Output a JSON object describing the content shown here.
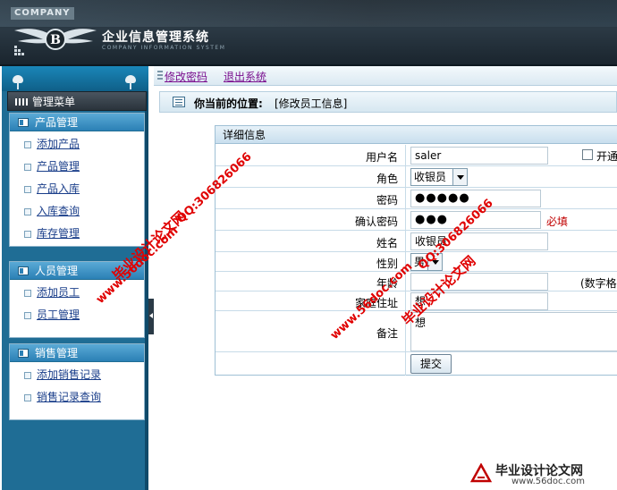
{
  "header": {
    "company_tag": "COMPANY",
    "title": "企业信息管理系统",
    "subtitle": "COMPANY INFORMATION SYSTEM",
    "logo_letter": "B"
  },
  "toolbar": {
    "change_password": "修改密码",
    "logout": "退出系统"
  },
  "sidebar": {
    "menu_title": "管理菜单",
    "groups": [
      {
        "title": "产品管理",
        "items": [
          "添加产品",
          "产品管理",
          "产品入库",
          "入库查询",
          "库存管理"
        ]
      },
      {
        "title": "人员管理",
        "items": [
          "添加员工",
          "员工管理"
        ]
      },
      {
        "title": "销售管理",
        "items": [
          "添加销售记录",
          "销售记录查询"
        ]
      }
    ]
  },
  "location": {
    "label": "你当前的位置:",
    "value": "[修改员工信息]"
  },
  "form": {
    "header": "详细信息",
    "username_label": "用户名",
    "username_value": "saler",
    "enable_label": "开通",
    "role_label": "角色",
    "role_value": "收银员",
    "password_label": "密码",
    "password_value": "●●●●●",
    "confirm_label": "确认密码",
    "confirm_value": "●●●",
    "required_text": "必填",
    "name_label": "姓名",
    "name_value": "收银员",
    "gender_label": "性别",
    "gender_value": "男",
    "age_label": "年龄",
    "age_value": "",
    "age_hint": "(数字格",
    "address_label": "家庭住址",
    "address_value": "想",
    "remark_label": "备注",
    "remark_value": "想",
    "submit_label": "提交"
  },
  "watermarks": {
    "site_name": "毕业设计论文网",
    "site_url": "www.56doc.com",
    "qq": "QQ:306826066",
    "brand_url": "www.56doc.com"
  }
}
